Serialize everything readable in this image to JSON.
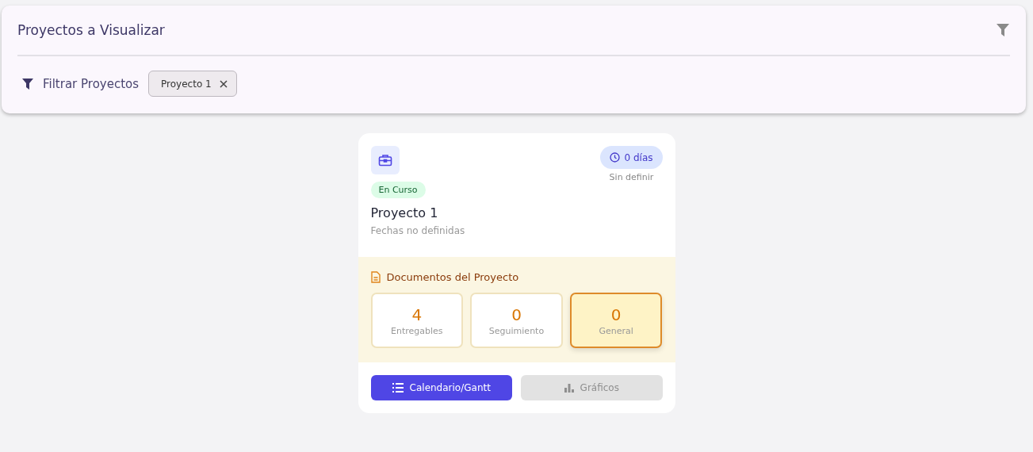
{
  "header": {
    "title": "Proyectos a Visualizar",
    "filter_label": "Filtrar Proyectos",
    "chips": [
      {
        "label": "Proyecto 1"
      }
    ]
  },
  "projects": [
    {
      "status": "En Curso",
      "days": "0 días",
      "days_note": "Sin definir",
      "name": "Proyecto 1",
      "dates": "Fechas no definidas",
      "documents_title": "Documentos del Proyecto",
      "documents": [
        {
          "count": "4",
          "label": "Entregables",
          "selected": false
        },
        {
          "count": "0",
          "label": "Seguimiento",
          "selected": false
        },
        {
          "count": "0",
          "label": "General",
          "selected": true
        }
      ],
      "actions": [
        {
          "kind": "list",
          "label": "Calendario/Gantt",
          "disabled": false
        },
        {
          "kind": "chart",
          "label": "Gráficos",
          "disabled": true
        }
      ]
    }
  ]
}
